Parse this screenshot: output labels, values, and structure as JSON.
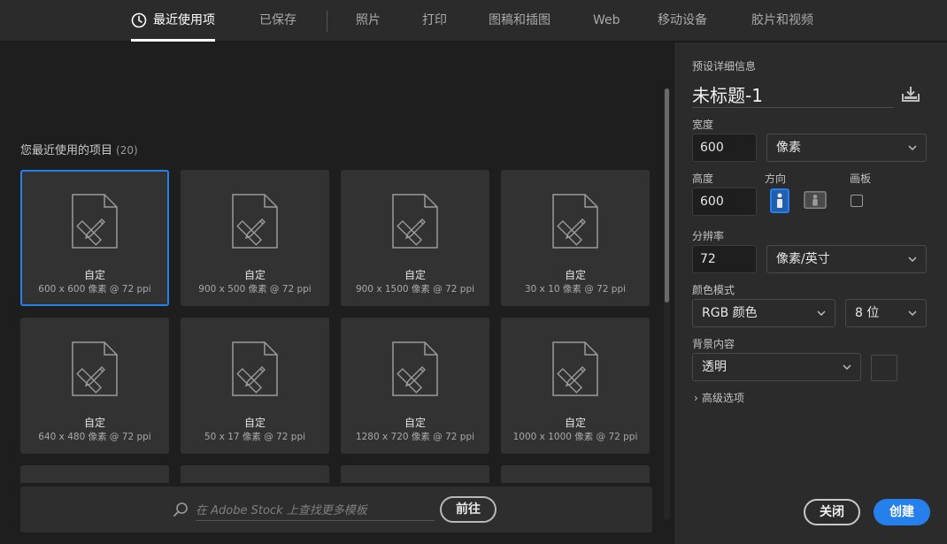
{
  "tabs": [
    {
      "label": "最近使用项",
      "active": true
    },
    {
      "label": "已保存"
    },
    {
      "label": "照片"
    },
    {
      "label": "打印"
    },
    {
      "label": "图稿和插图"
    },
    {
      "label": "Web"
    },
    {
      "label": "移动设备"
    },
    {
      "label": "胶片和视频"
    }
  ],
  "recent": {
    "title": "您最近使用的项目",
    "count": "(20)",
    "items": [
      {
        "name": "自定",
        "detail": "600 x 600 像素 @ 72 ppi",
        "selected": true
      },
      {
        "name": "自定",
        "detail": "900 x 500 像素 @ 72 ppi"
      },
      {
        "name": "自定",
        "detail": "900 x 1500 像素 @ 72 ppi"
      },
      {
        "name": "自定",
        "detail": "30 x 10 像素 @ 72 ppi"
      },
      {
        "name": "自定",
        "detail": "640 x 480 像素 @ 72 ppi"
      },
      {
        "name": "自定",
        "detail": "50 x 17 像素 @ 72 ppi"
      },
      {
        "name": "自定",
        "detail": "1280 x 720 像素 @ 72 ppi"
      },
      {
        "name": "自定",
        "detail": "1000 x 1000 像素 @ 72 ppi"
      }
    ]
  },
  "search": {
    "placeholder": "在 Adobe Stock 上查找更多模板",
    "go_label": "前往"
  },
  "details": {
    "heading": "预设详细信息",
    "doc_title": "未标题-1",
    "width_label": "宽度",
    "width_value": "600",
    "width_unit": "像素",
    "height_label": "高度",
    "height_value": "600",
    "orientation_label": "方向",
    "artboard_label": "画板",
    "resolution_label": "分辨率",
    "resolution_value": "72",
    "resolution_unit": "像素/英寸",
    "color_mode_label": "颜色模式",
    "color_mode_value": "RGB 颜色",
    "bit_depth_value": "8 位",
    "background_label": "背景内容",
    "background_value": "透明",
    "advanced_label": "高级选项"
  },
  "buttons": {
    "close_label": "关闭",
    "create_label": "创建"
  },
  "colors": {
    "accent": "#2680eb",
    "panel": "#2b2b2b",
    "background": "#1e1e1e",
    "card": "#323232"
  }
}
